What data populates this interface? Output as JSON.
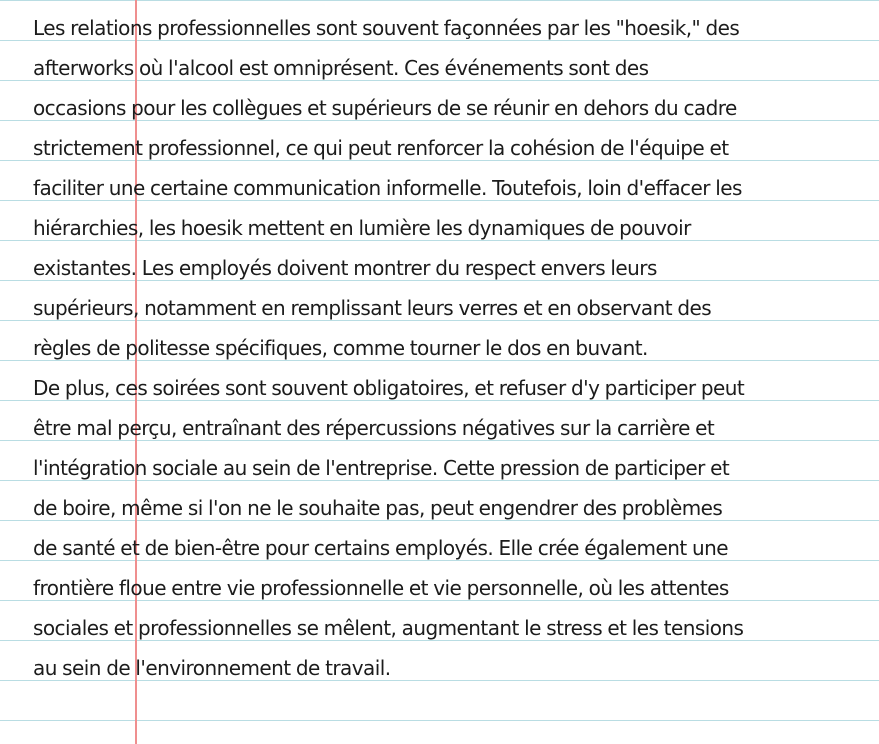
{
  "document": {
    "paragraphs": [
      {
        "lines": [
          "Les relations professionnelles sont souvent façonnées par les \"hoesik,\" des",
          "afterworks où l'alcool est omniprésent. Ces événements sont des",
          "occasions pour les collègues et supérieurs de se réunir en dehors du cadre",
          "strictement professionnel, ce qui peut renforcer la cohésion de l'équipe et",
          "faciliter une certaine communication informelle. Toutefois, loin d'effacer les",
          "hiérarchies, les hoesik mettent en lumière les dynamiques de pouvoir",
          "existantes. Les employés doivent montrer du respect envers leurs",
          "supérieurs, notamment en remplissant leurs verres et en observant des",
          "règles de politesse spécifiques, comme tourner le dos en buvant."
        ]
      },
      {
        "lines": [
          "De plus, ces soirées sont souvent obligatoires, et refuser d'y participer peut",
          "être mal perçu, entraînant des répercussions négatives sur la carrière et",
          "l'intégration sociale au sein de l'entreprise. Cette pression de participer et",
          "de boire, même si l'on ne le souhaite pas, peut engendrer des problèmes",
          "de santé et de bien-être pour certains employés. Elle crée également une",
          "frontière floue entre vie professionnelle et vie personnelle, où les attentes",
          "sociales et professionnelles se mêlent, augmentant le stress et les tensions",
          "au sein de l'environnement de travail."
        ]
      }
    ]
  },
  "colors": {
    "rule_line": "#b9dde3",
    "margin_line": "#ef8f8f",
    "text": "#1c1c1c",
    "background": "#ffffff"
  }
}
